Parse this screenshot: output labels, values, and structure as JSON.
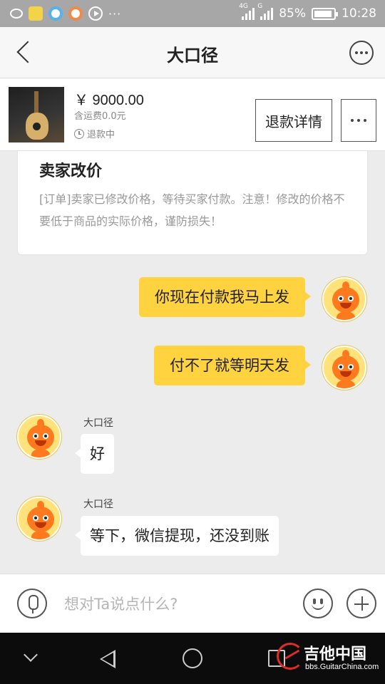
{
  "status_bar": {
    "network_type": "4G",
    "network_label": "G",
    "battery": "85%",
    "time": "10:28",
    "more_indicator": "···"
  },
  "header": {
    "title": "大口径"
  },
  "product": {
    "price": "￥ 9000.00",
    "shipping": "含运费0.0元",
    "status": "退款中",
    "refund_button": "退款详情"
  },
  "notice": {
    "title": "卖家改价",
    "body": "[订单]卖家已修改价格，等待买家付款。注意！修改的价格不要低于商品的实际价格，谨防损失！"
  },
  "messages": [
    {
      "side": "right",
      "text": "你现在付款我马上发"
    },
    {
      "side": "right",
      "text": "付不了就等明天发"
    },
    {
      "side": "left",
      "sender": "大口径",
      "text": "好"
    },
    {
      "side": "left",
      "sender": "大口径",
      "text": "等下，微信提现，还没到账"
    }
  ],
  "input": {
    "placeholder": "想对Ta说点什么?"
  },
  "watermark": {
    "title": "吉他中国",
    "url": "bbs.GuitarChina.com"
  },
  "colors": {
    "bubble_self": "#ffd23f",
    "bubble_other": "#ffffff",
    "chat_background": "#ececec",
    "avatar_orange": "#ff7a1f"
  },
  "icons": [
    "back-arrow-icon",
    "more-icon",
    "clock-icon",
    "mic-icon",
    "emoji-icon",
    "plus-icon",
    "nav-down-icon",
    "nav-back-icon",
    "nav-home-icon",
    "nav-recent-icon"
  ]
}
